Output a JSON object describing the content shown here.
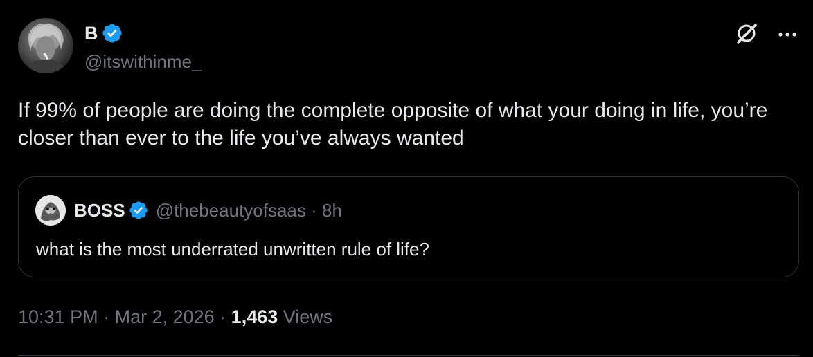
{
  "author": {
    "display_name": "B",
    "handle": "@itswithinme_",
    "verified": true
  },
  "tweet": {
    "text": "If 99% of people are doing the complete opposite of what your doing in life, you’re closer than ever to the life you’ve always wanted"
  },
  "quoted_tweet": {
    "display_name": "BOSS",
    "handle": "@thebeautyofsaas",
    "separator": "·",
    "age": "8h",
    "verified": true,
    "text": "what is the most underrated unwritten rule of life?"
  },
  "meta": {
    "time": "10:31 PM",
    "sep1": " · ",
    "date": "Mar 2, 2026",
    "sep2": " · ",
    "views_count": "1,463",
    "views_label": " Views"
  },
  "icons": {
    "verified": "verified-badge-icon",
    "grok": "grok-icon",
    "more": "more-icon"
  },
  "colors": {
    "background": "#000000",
    "primary_text": "#e7e9ea",
    "secondary_text": "#71767b",
    "verified_blue": "#1d9bf0",
    "border": "#2f3336"
  }
}
